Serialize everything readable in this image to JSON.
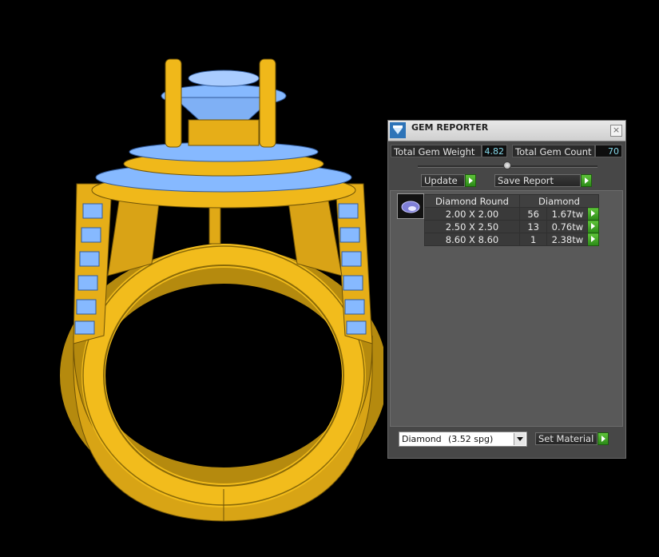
{
  "panel": {
    "title": "GEM REPORTER",
    "close": "×",
    "total_weight_label": "Total Gem Weight",
    "total_weight_value": "4.82",
    "total_count_label": "Total Gem Count",
    "total_count_value": "70",
    "update_label": "Update",
    "save_report_label": "Save Report",
    "table": {
      "headers": [
        "Diamond Round",
        "Diamond"
      ],
      "rows": [
        {
          "size": "2.00 X 2.00",
          "count": "56",
          "weight": "1.67tw"
        },
        {
          "size": "2.50 X 2.50",
          "count": "13",
          "weight": "0.76tw"
        },
        {
          "size": "8.60 X 8.60",
          "count": "1",
          "weight": "2.38tw"
        }
      ]
    },
    "material": {
      "name": "Diamond",
      "density": "(3.52 spg)"
    },
    "set_material_label": "Set Material"
  },
  "colors": {
    "metal": "#f2bc1c",
    "gem": "#86b9ff",
    "background": "#000000",
    "accent_green": "#3aa81f"
  }
}
